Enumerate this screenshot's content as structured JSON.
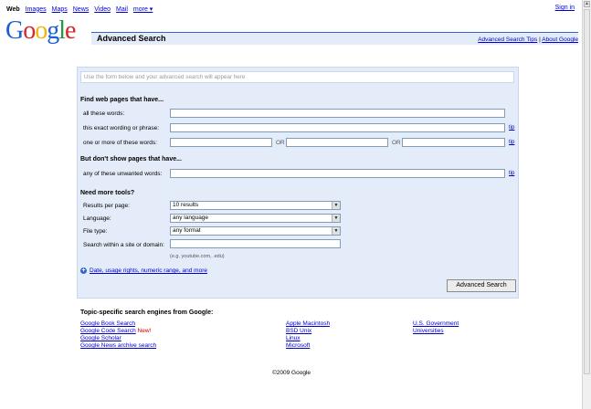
{
  "nav": {
    "items": [
      {
        "label": "Web",
        "current": true
      },
      {
        "label": "Images",
        "current": false
      },
      {
        "label": "Maps",
        "current": false
      },
      {
        "label": "News",
        "current": false
      },
      {
        "label": "Video",
        "current": false
      },
      {
        "label": "Mail",
        "current": false
      },
      {
        "label": "more ▾",
        "current": false
      }
    ],
    "sign_in": "Sign in"
  },
  "logo": {
    "letters": [
      {
        "char": "G",
        "color": "#1a5fd4"
      },
      {
        "char": "o",
        "color": "#d6262a"
      },
      {
        "char": "o",
        "color": "#f2b50f"
      },
      {
        "char": "g",
        "color": "#1a5fd4"
      },
      {
        "char": "l",
        "color": "#239a3b"
      },
      {
        "char": "e",
        "color": "#d6262a"
      }
    ]
  },
  "header": {
    "title": "Advanced Search",
    "tips_link": "Advanced Search Tips",
    "separator": "|",
    "about_link": "About Google"
  },
  "form": {
    "query_placeholder": "Use the form below and your advanced search will appear here",
    "find_section": {
      "title": "Find web pages that have...",
      "all_words": "all these words:",
      "exact_phrase": "this exact wording or phrase:",
      "any_words": "one or more of these words:",
      "or_label": "OR",
      "tip": "tip"
    },
    "exclude_section": {
      "title": "But don't show pages that have...",
      "unwanted_words": "any of these unwanted words:",
      "tip": "tip"
    },
    "tools_section": {
      "title": "Need more tools?",
      "results_per_page": {
        "label": "Results per page:",
        "value": "10 results"
      },
      "language": {
        "label": "Language:",
        "value": "any language"
      },
      "file_type": {
        "label": "File type:",
        "value": "any format"
      },
      "site_domain": {
        "label": "Search within a site or domain:",
        "hint": "(e.g. youtube.com, .edu)"
      }
    },
    "more_options": "Date, usage rights, numeric range, and more",
    "submit": "Advanced Search"
  },
  "topics": {
    "title": "Topic-specific search engines from Google:",
    "col1": [
      "Google Book Search",
      "Google Code Search",
      "Google Scholar",
      "Google News archive search"
    ],
    "new_badge": "New!",
    "col2": [
      "Apple Macintosh",
      "BSD Unix",
      "Linux",
      "Microsoft"
    ],
    "col3": [
      "U.S. Government",
      "Universities"
    ]
  },
  "footer": {
    "copyright": "©2009 Google"
  }
}
